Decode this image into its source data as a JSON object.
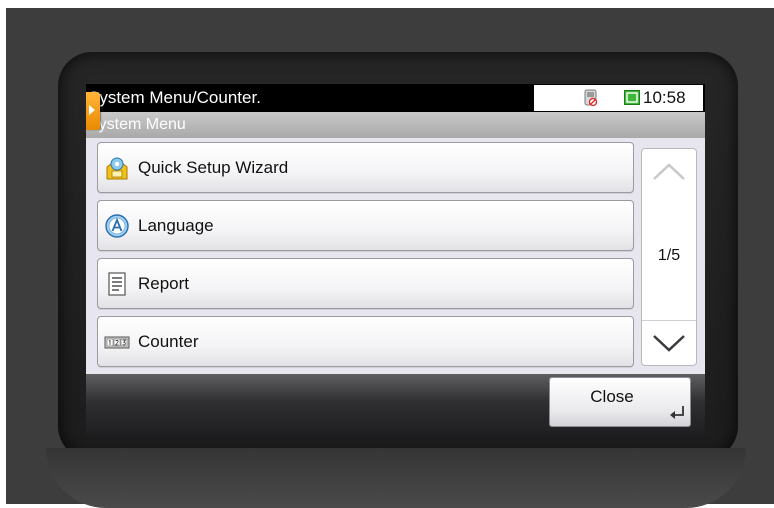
{
  "status_bar": {
    "title": "System Menu/Counter.",
    "time": "10:58",
    "network_icon": "network-disconnected-icon",
    "status_icon": "device-status-icon"
  },
  "header": {
    "title": "System Menu",
    "back_icon": "back-tab-icon"
  },
  "menu": {
    "items": [
      {
        "label": "Quick Setup Wizard",
        "icon": "wizard-icon"
      },
      {
        "label": "Language",
        "icon": "language-icon"
      },
      {
        "label": "Report",
        "icon": "report-icon"
      },
      {
        "label": "Counter",
        "icon": "counter-icon"
      }
    ]
  },
  "pagination": {
    "indicator": "1/5"
  },
  "footer": {
    "close_label": "Close"
  },
  "colors": {
    "accent": "#f39a12",
    "status_green": "#3fb83a",
    "list_background": "#e7e6ee"
  }
}
